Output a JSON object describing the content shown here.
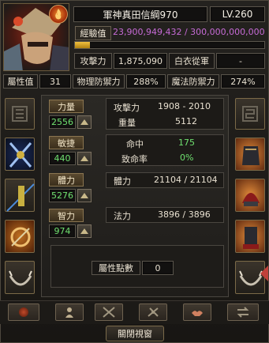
{
  "header": {
    "name": "軍神真田信綱970",
    "level": "LV.260"
  },
  "exp": {
    "label": "經驗值",
    "value": "23,900,949,432 / 300,000,000,000",
    "fill_fraction": 0.08
  },
  "attack_row": {
    "label": "攻擊力",
    "value": "1,875,090",
    "guild": "白衣從軍",
    "guild_value": "-"
  },
  "stats_row": {
    "attr_label": "屬性值",
    "attr_value": "31",
    "pdef_label": "物理防禦力",
    "pdef_value": "288%",
    "mdef_label": "魔法防禦力",
    "mdef_value": "274%"
  },
  "attributes": [
    {
      "label": "力量",
      "value": "2556"
    },
    {
      "label": "敏捷",
      "value": "440"
    },
    {
      "label": "體力",
      "value": "5276"
    },
    {
      "label": "智力",
      "value": "974"
    }
  ],
  "details": {
    "attack_label": "攻擊力",
    "attack_value": "1908 - 2010",
    "weight_label": "重量",
    "weight_value": "5112",
    "hit_label": "命中",
    "hit_value": "175",
    "crit_label": "致命率",
    "crit_value": "0%",
    "hp_label": "體力",
    "hp_value": "21104 / 21104",
    "mp_label": "法力",
    "mp_value": "3896 / 3896"
  },
  "points": {
    "label": "屬性點數",
    "value": "0"
  },
  "footer": {
    "close_label": "關閉視窗"
  },
  "colors": {
    "exp_bar": "#d2a21c",
    "exp_text": "#c66bd6",
    "green_text": "#6fe06f"
  }
}
